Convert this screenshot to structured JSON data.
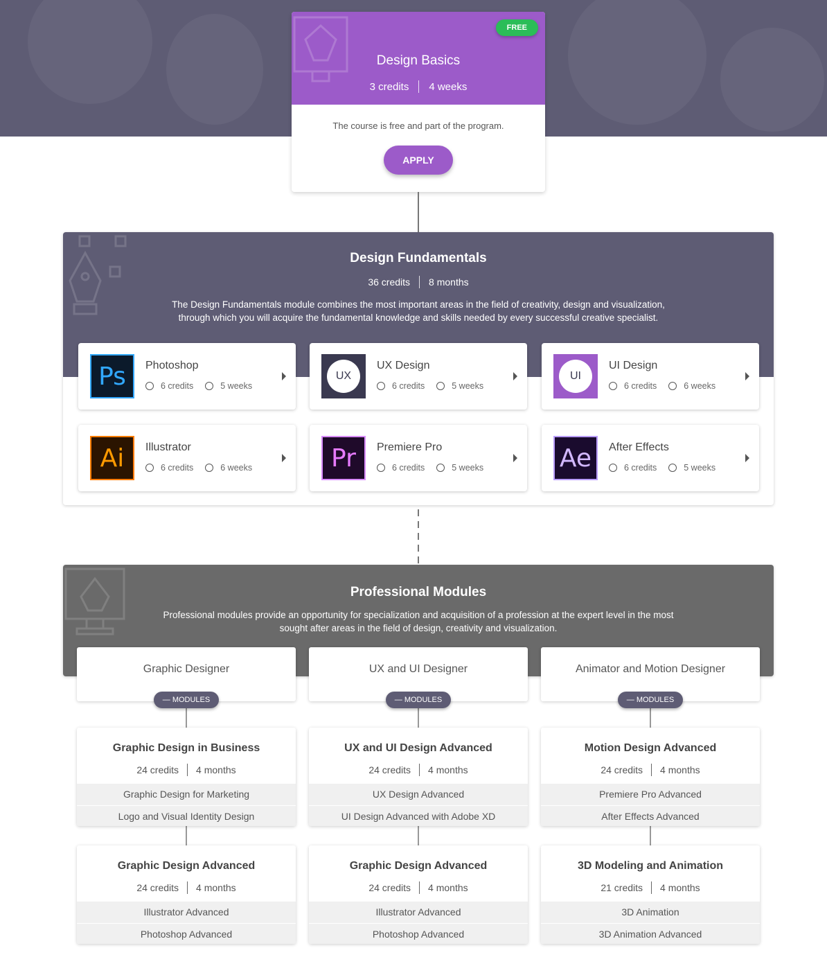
{
  "basics": {
    "badge": "FREE",
    "title": "Design Basics",
    "credits": "3 credits",
    "duration": "4 weeks",
    "description": "The course is free and part of the program.",
    "apply_label": "APPLY",
    "accent_color": "#9c5bc9"
  },
  "fundamentals": {
    "title": "Design Fundamentals",
    "credits": "36 credits",
    "duration": "8 months",
    "description_line1": "The Design Fundamentals module combines the most important areas in the field of creativity, design and visualization,",
    "description_line2": "through which you will acquire the fundamental knowledge and skills needed by every successful creative specialist.",
    "courses": [
      {
        "name": "Photoshop",
        "credits": "6 credits",
        "duration": "5 weeks",
        "icon": "Ps"
      },
      {
        "name": "UX Design",
        "credits": "6 credits",
        "duration": "5 weeks",
        "icon": "UX"
      },
      {
        "name": "UI Design",
        "credits": "6 credits",
        "duration": "6 weeks",
        "icon": "UI"
      },
      {
        "name": "Illustrator",
        "credits": "6 credits",
        "duration": "6 weeks",
        "icon": "Ai"
      },
      {
        "name": "Premiere Pro",
        "credits": "6 credits",
        "duration": "5 weeks",
        "icon": "Pr"
      },
      {
        "name": "After Effects",
        "credits": "6 credits",
        "duration": "5 weeks",
        "icon": "Ae"
      }
    ]
  },
  "professional": {
    "title": "Professional Modules",
    "description_line1": "Professional modules provide an opportunity for specialization and acquisition of a profession at the expert level in the most",
    "description_line2": "sought after areas in the field of design, creativity and visualization.",
    "modules_label": "MODULES",
    "tracks": [
      {
        "title": "Graphic Designer",
        "modules": [
          {
            "title": "Graphic Design in Business",
            "credits": "24 credits",
            "duration": "4 months",
            "items": [
              "Graphic Design for Marketing",
              "Logo and Visual Identity Design"
            ]
          },
          {
            "title": "Graphic Design Advanced",
            "credits": "24 credits",
            "duration": "4 months",
            "items": [
              "Illustrator Advanced",
              "Photoshop Advanced"
            ]
          }
        ]
      },
      {
        "title": "UX and UI Designer",
        "modules": [
          {
            "title": "UX and UI Design Advanced",
            "credits": "24 credits",
            "duration": "4 months",
            "items": [
              "UX Design Advanced",
              "UI Design Advanced with Adobe XD"
            ]
          },
          {
            "title": "Graphic Design Advanced",
            "credits": "24 credits",
            "duration": "4 months",
            "items": [
              "Illustrator Advanced",
              "Photoshop Advanced"
            ]
          }
        ]
      },
      {
        "title": "Animator and Motion Designer",
        "modules": [
          {
            "title": "Motion Design Advanced",
            "credits": "24 credits",
            "duration": "4 months",
            "items": [
              "Premiere Pro Advanced",
              "After Effects Advanced"
            ]
          },
          {
            "title": "3D Modeling and Animation",
            "credits": "21 credits",
            "duration": "4 months",
            "items": [
              "3D Animation",
              "3D Animation Advanced"
            ]
          }
        ]
      }
    ]
  }
}
